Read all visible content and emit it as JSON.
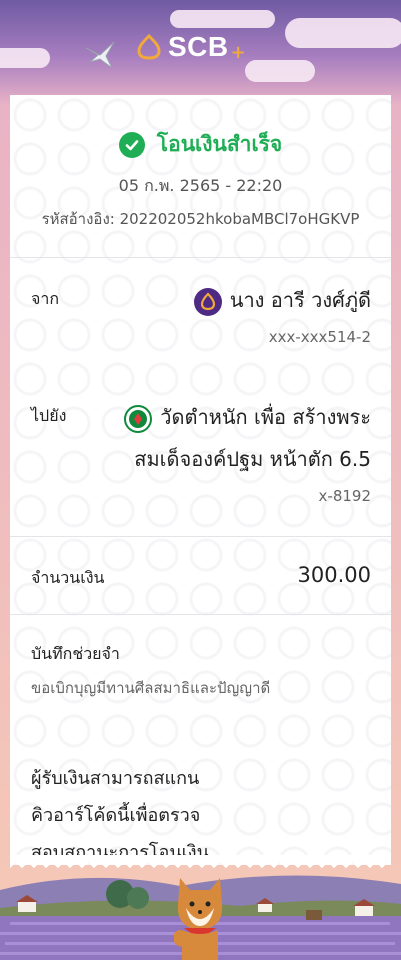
{
  "header": {
    "brand": "SCB",
    "plus": "+"
  },
  "status": {
    "title": "โอนเงินสำเร็จ",
    "datetime": "05 ก.พ. 2565 - 22:20",
    "reference": "รหัสอ้างอิง: 202202052hkobaMBCl7oHGKVP"
  },
  "from": {
    "label": "จาก",
    "name": "นาง อารี วงศ์ภู่ดี",
    "account": "xxx-xxx514-2"
  },
  "to": {
    "label": "ไปยัง",
    "name_line1": "วัดตำหนัก เพื่อ สร้างพระ",
    "name_line2": "สมเด็จองค์ปฐม หน้าตัก 6.5",
    "account": "x-8192"
  },
  "amount": {
    "label": "จำนวนเงิน",
    "value": "300.00"
  },
  "memo": {
    "label": "บันทึกช่วยจำ",
    "text": "ขอเบิกบุญมีทานศีลสมาธิและปัญญาดี"
  },
  "scan_note": {
    "line1": "ผู้รับเงินสามารถสแกน",
    "line2": "คิวอาร์โค้ดนี้เพื่อตรวจ",
    "line3": "สอบสถานะการโอนเงิน"
  },
  "colors": {
    "success": "#1fae55",
    "scb_purple": "#4e2a84",
    "scb_gold": "#f1a93b",
    "ktb_green": "#0f8a3c"
  },
  "icons": {
    "status": "check-circle-icon",
    "sender_bank": "scb-bank-icon",
    "receiver_bank": "ktb-bank-icon"
  }
}
